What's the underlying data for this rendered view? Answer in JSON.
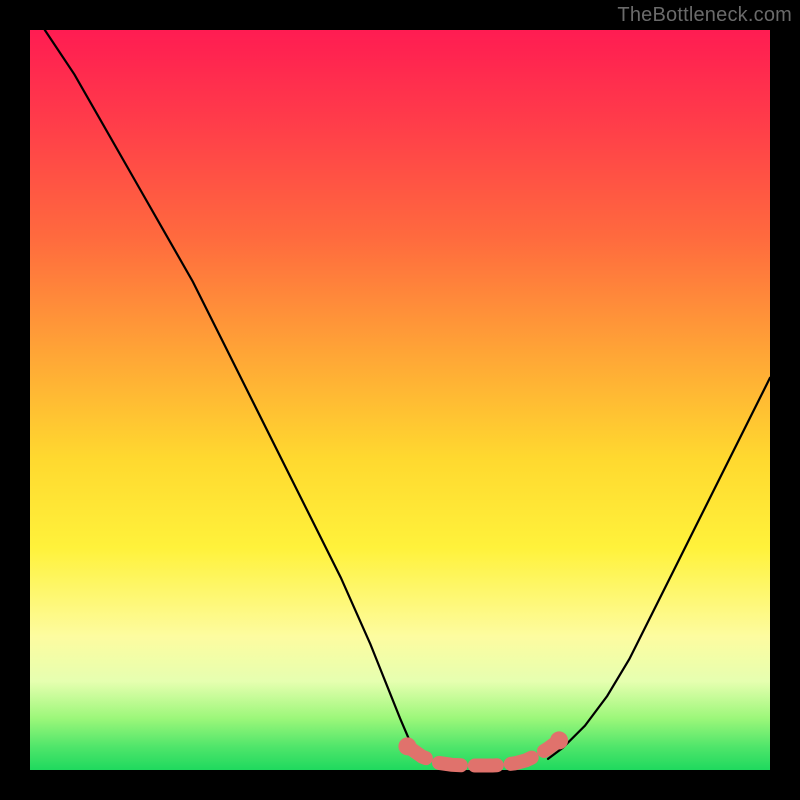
{
  "watermark": "TheBottleneck.com",
  "chart_data": {
    "type": "line",
    "title": "",
    "xlabel": "",
    "ylabel": "",
    "xlim": [
      0,
      100
    ],
    "ylim": [
      0,
      100
    ],
    "grid": false,
    "series": [
      {
        "name": "curve-left",
        "color": "#000000",
        "style": "solid",
        "x": [
          2,
          6,
          10,
          14,
          18,
          22,
          26,
          30,
          34,
          38,
          42,
          46,
          48,
          50,
          51.5,
          52.5
        ],
        "y": [
          100,
          94,
          87,
          80,
          73,
          66,
          58,
          50,
          42,
          34,
          26,
          17,
          12,
          7,
          3.5,
          1.5
        ]
      },
      {
        "name": "curve-right",
        "color": "#000000",
        "style": "solid",
        "x": [
          70,
          72,
          75,
          78,
          81,
          84,
          87,
          90,
          93,
          96,
          99,
          100
        ],
        "y": [
          1.5,
          3,
          6,
          10,
          15,
          21,
          27,
          33,
          39,
          45,
          51,
          53
        ]
      },
      {
        "name": "flat-segment",
        "color": "#e0726c",
        "style": "dotted-thick",
        "x": [
          51,
          53,
          55,
          57,
          59,
          61,
          62.5,
          64,
          65.5,
          67,
          68.5,
          70,
          71.5
        ],
        "y": [
          3.2,
          1.8,
          1.0,
          0.7,
          0.6,
          0.6,
          0.6,
          0.7,
          0.9,
          1.3,
          2.0,
          2.9,
          4.0
        ]
      }
    ]
  }
}
